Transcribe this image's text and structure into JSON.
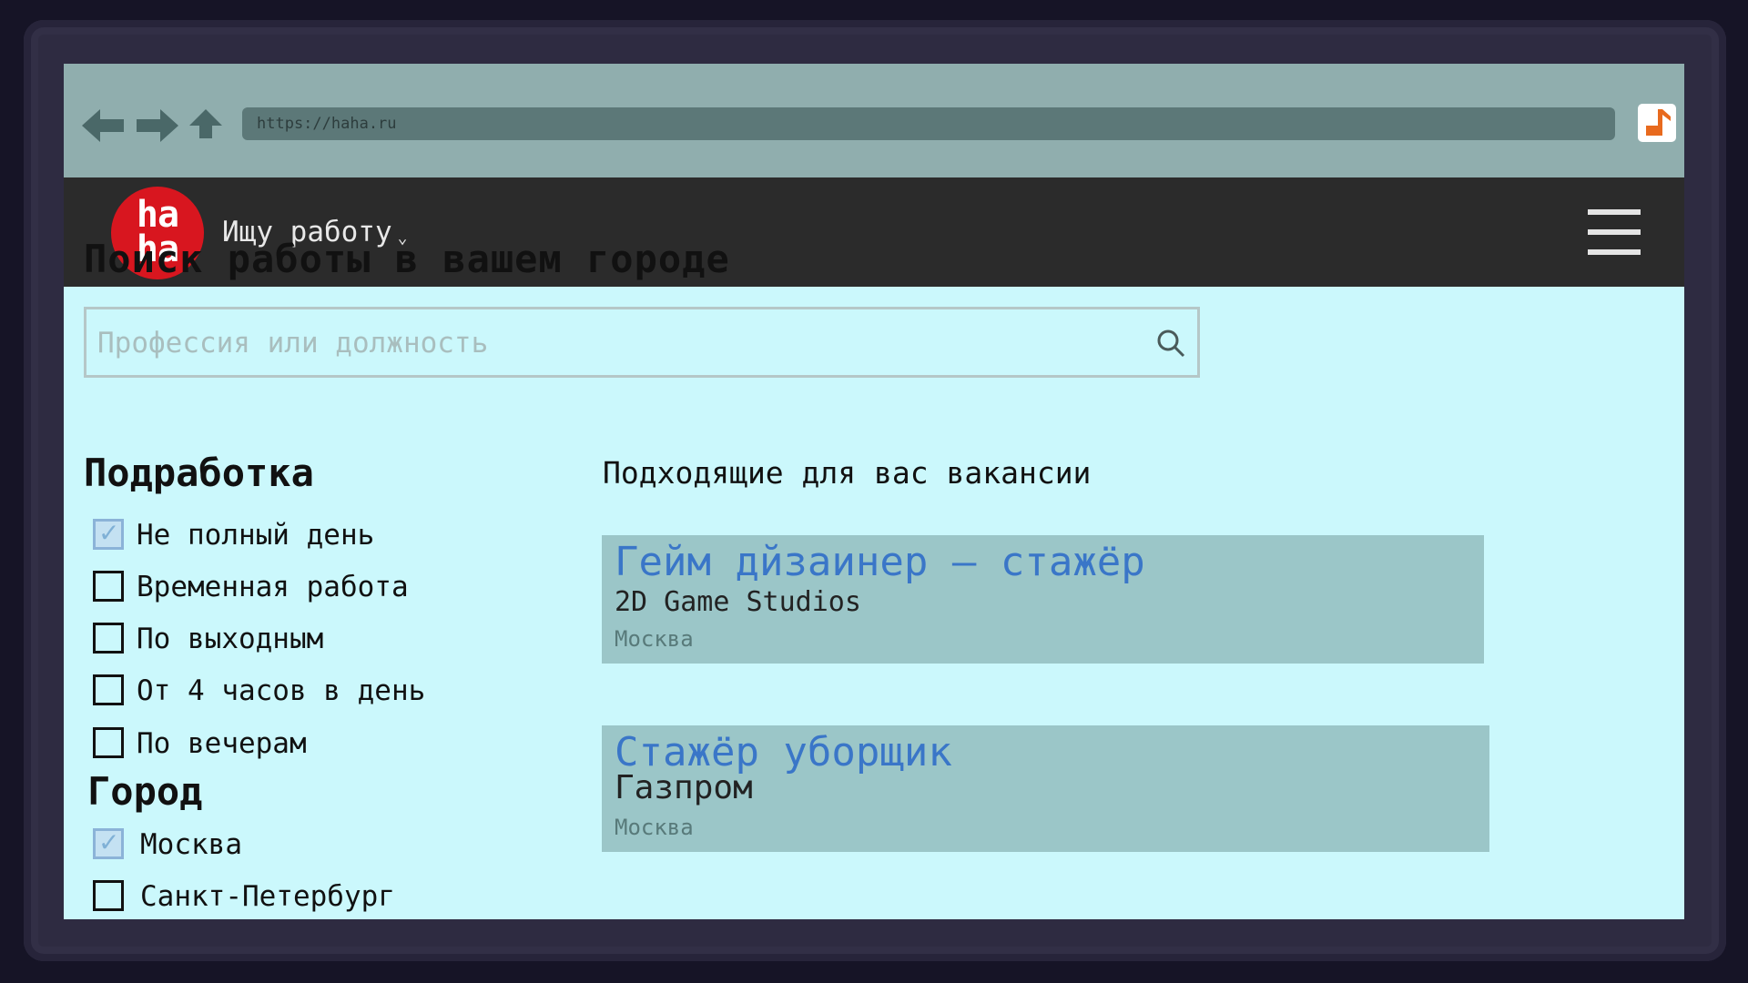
{
  "browser": {
    "url": "https://haha.ru",
    "colors": {
      "bar": "#90aeae",
      "url_bg": "#5c7878",
      "extension_icon": "#e86a1e"
    },
    "icons": [
      "arrow-left-icon",
      "arrow-right-icon",
      "arrow-up-icon",
      "music-note-icon"
    ]
  },
  "header": {
    "logo_line1": "ha",
    "logo_line2": "ha",
    "role_select": "Ищу работу",
    "colors": {
      "bg": "#2b2b2b",
      "logo": "#d8161f"
    },
    "icons": [
      "chevron-down-icon",
      "hamburger-menu-icon"
    ]
  },
  "main": {
    "title": "Поиск работы в вашем городе",
    "search": {
      "placeholder": "Профессия или должность",
      "value": ""
    },
    "filters": {
      "employment": {
        "heading": "Подработка",
        "options": [
          {
            "label": "Не полный день",
            "checked": true
          },
          {
            "label": "Временная работа",
            "checked": false
          },
          {
            "label": "По выходным",
            "checked": false
          },
          {
            "label": "От 4 часов в день",
            "checked": false
          },
          {
            "label": "По вечерам",
            "checked": false
          }
        ]
      },
      "city": {
        "heading": "Город",
        "options": [
          {
            "label": "Москва",
            "checked": true
          },
          {
            "label": "Санкт-Петербург",
            "checked": false
          }
        ]
      }
    },
    "vacancies_title": "Подходящие для вас вакансии",
    "vacancies": [
      {
        "title": "Гейм дйзаинер – стажёр",
        "company": "2D Game Studios",
        "city": "Москва"
      },
      {
        "title": "Стажёр уборщик",
        "company": "Газпром",
        "city": "Москва"
      }
    ],
    "colors": {
      "page_bg": "#cbf8fc",
      "card_bg": "#9bc6c8",
      "link": "#3a76c8"
    }
  }
}
